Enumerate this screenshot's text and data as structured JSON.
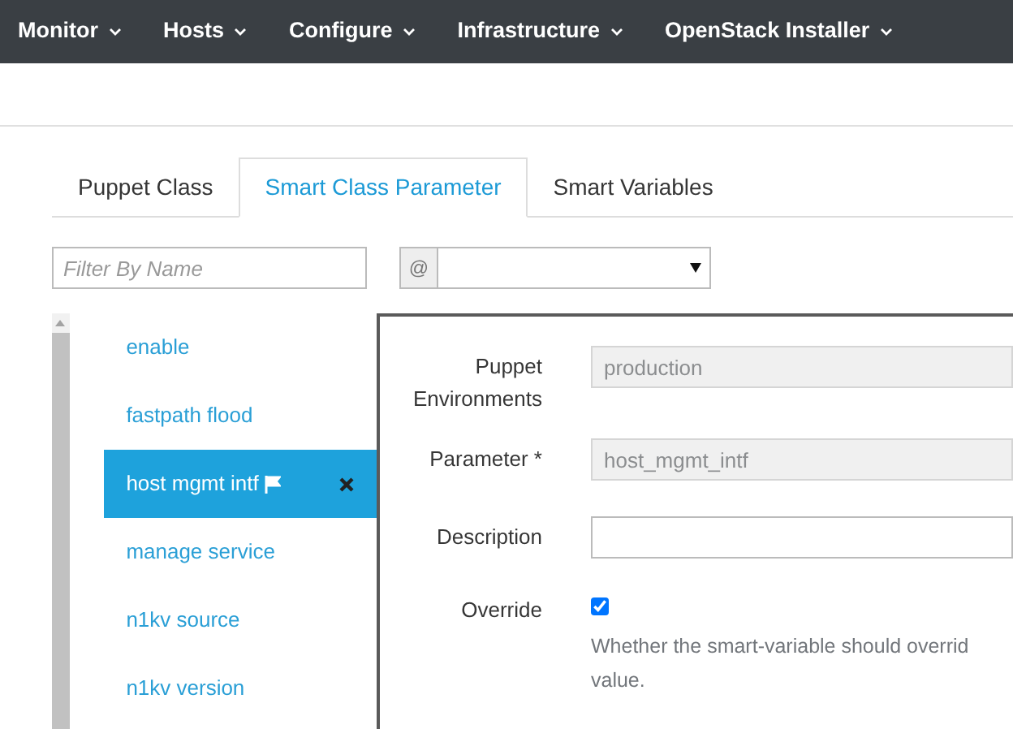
{
  "navbar": {
    "items": [
      {
        "label": "Monitor"
      },
      {
        "label": "Hosts"
      },
      {
        "label": "Configure"
      },
      {
        "label": "Infrastructure"
      },
      {
        "label": "OpenStack Installer"
      }
    ]
  },
  "tabs": [
    {
      "label": "Puppet Class",
      "selected": false
    },
    {
      "label": "Smart Class Parameter",
      "selected": true
    },
    {
      "label": "Smart Variables",
      "selected": false
    }
  ],
  "filter": {
    "placeholder": "Filter By Name"
  },
  "environment_select": {
    "addon": "@"
  },
  "parameters": [
    {
      "label": "enable",
      "selected": false
    },
    {
      "label": "fastpath flood",
      "selected": false
    },
    {
      "label": "host mgmt intf",
      "selected": true
    },
    {
      "label": "manage service",
      "selected": false
    },
    {
      "label": "n1kv source",
      "selected": false
    },
    {
      "label": "n1kv version",
      "selected": false
    }
  ],
  "form": {
    "fields": [
      {
        "kind": "text",
        "label": "Puppet Environments",
        "value": "production",
        "disabled": true
      },
      {
        "kind": "text",
        "label": "Parameter *",
        "value": "host_mgmt_intf",
        "disabled": true
      },
      {
        "kind": "text",
        "label": "Description",
        "disabled": false
      },
      {
        "kind": "checkbox",
        "label": "Override",
        "checked": true,
        "help": [
          "Whether the smart-variable should overrid",
          "value."
        ]
      }
    ]
  }
}
